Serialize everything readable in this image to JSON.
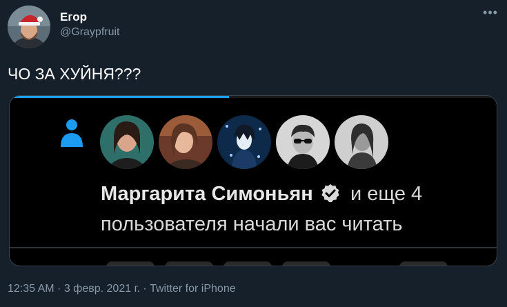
{
  "author": {
    "display_name": "Егор",
    "handle": "@Graypfruit"
  },
  "tweet": {
    "text": "ЧО ЗА ХУЙНЯ???"
  },
  "media": {
    "video_progress": 0.45,
    "notification": {
      "name": "Маргарита Симоньян",
      "rest_line1": " и еще 4",
      "line2": "пользователя начали вас читать",
      "icon": "person-icon",
      "follower_count_shown": 5
    }
  },
  "meta": {
    "time": "12:35 AM",
    "separator": " · ",
    "date": "3 февр. 2021 г.",
    "source": "Twitter for iPhone"
  },
  "colors": {
    "background": "#15202b",
    "accent": "#1da1f2",
    "secondary_text": "#8899a6"
  }
}
